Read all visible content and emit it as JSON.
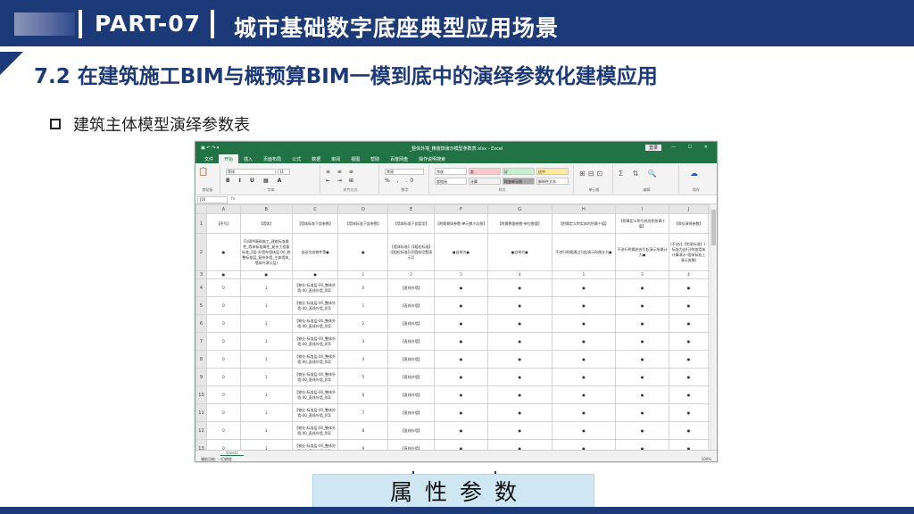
{
  "header": {
    "part": "PART-07",
    "title": "城市基础数字底座典型应用场景"
  },
  "section": {
    "title": "7.2 在建筑施工BIM与概预算BIM一模到底中的演绎参数化建模应用"
  },
  "bullet": {
    "text": "建筑主体模型演绎参数表"
  },
  "excel": {
    "window_title": "_整体外墙_精装饰演示模型参数表.xlsx - Excel",
    "sign_in": "登录",
    "tabs": [
      "文件",
      "开始",
      "插入",
      "页面布局",
      "公式",
      "数据",
      "审阅",
      "视图",
      "帮助",
      "百度网盘",
      "操作说明搜索"
    ],
    "ribbon": {
      "groups": [
        "剪贴板",
        "字体",
        "对齐方式",
        "数字",
        "样式",
        "单元格",
        "编辑",
        "保存"
      ],
      "font_name": "等线",
      "font_size": "11",
      "number_format": "常规",
      "styles": [
        {
          "label": "常规",
          "bg": "#ffffff"
        },
        {
          "label": "差",
          "bg": "#ffc7ce"
        },
        {
          "label": "好",
          "bg": "#c6efce"
        },
        {
          "label": "适中",
          "bg": "#ffeb9c"
        },
        {
          "label": "超链接",
          "bg": "#ffffff"
        },
        {
          "label": "计算",
          "bg": "#f2f2f2"
        },
        {
          "label": "检查单元格",
          "bg": "#a5a5a5"
        },
        {
          "label": "解释性文本",
          "bg": "#ffffff"
        }
      ]
    },
    "formula_bar": {
      "name_box": "J16",
      "fx": "fx"
    },
    "column_letters": [
      "A",
      "B",
      "C",
      "D",
      "E",
      "F",
      "G",
      "H",
      "I",
      "J"
    ],
    "header_row": [
      "【序号】",
      "【墙体】",
      "【墙体标准下部参数】",
      "【墙体标准下部参数】",
      "【墙体标准下部类型】",
      "【附属物体参数-单元数小边框】",
      "【附属数据参数-单位数量】",
      "【附属定义附实体的所属十值】",
      "【附属定义附引结合附所属十值】",
      "【保存演绎参数】"
    ],
    "row2": [
      "●",
      "(1)BIM演绎施工_建筑标准属性_墙体标准属性_复杂工程量标准_2层-外墙布墙体层-00_修整标准层_复杂外墙_主体墙体_墙体外演示层)",
      "自动生成物件等●",
      "●",
      "【墙体标准】(【粗粒标准】(【粗粒标准】)(【墙体设置演示】)",
      "●自带为●",
      "●自带为●",
      "不进行附属通过引起演示所属计为●",
      "不进行附属结合引起演示所属计为●",
      "(不加注【附录标准】(-标准为自行)附加墙体计算演示-墙体标准上演示参数)"
    ],
    "row3": [
      "●",
      "●",
      "●",
      "1",
      "2",
      "3",
      "4",
      "1",
      "2",
      "4"
    ],
    "data_rows": [
      [
        "0",
        "1",
        "【物业-标准层-00_整体外墙-00_直线外墙_00】",
        "0",
        "【直线外墙】",
        "●",
        "●",
        "●",
        "●",
        "●"
      ],
      [
        "0",
        "1",
        "【物业-标准层-00_整体外墙-00_直线外墙_00】",
        "1",
        "【直线外墙】",
        "●",
        "●",
        "●",
        "●",
        "●"
      ],
      [
        "0",
        "1",
        "【物业-标准层-00_整体外墙-00_直线外墙_00】",
        "2",
        "【直线外墙】",
        "●",
        "●",
        "●",
        "●",
        "●"
      ],
      [
        "0",
        "1",
        "【物业-标准层-00_整体外墙-00_直线外墙_00】",
        "3",
        "【直线外墙】",
        "●",
        "●",
        "●",
        "●",
        "●"
      ],
      [
        "0",
        "1",
        "【物业-标准层-00_整体外墙-00_直线外墙_00】",
        "4",
        "【直线外墙】",
        "●",
        "●",
        "●",
        "●",
        "●"
      ],
      [
        "0",
        "1",
        "【物业-标准层-00_整体外墙-00_直线外墙_00】",
        "5",
        "【直线外墙】",
        "●",
        "●",
        "●",
        "●",
        "●"
      ],
      [
        "0",
        "1",
        "【物业-标准层-00_整体外墙-00_直线外墙_00】",
        "6",
        "【直线外墙】",
        "●",
        "●",
        "●",
        "●",
        "●"
      ],
      [
        "0",
        "1",
        "【物业-标准层-00_整体外墙-00_直线外墙_00】",
        "7",
        "【直线外墙】",
        "●",
        "●",
        "●",
        "●",
        "●"
      ],
      [
        "0",
        "1",
        "【物业-标准层-00_整体外墙-00_直线外墙_00】",
        "8",
        "【直线外墙】",
        "●",
        "●",
        "●",
        "●",
        "●"
      ],
      [
        "0",
        "1",
        "【物业-标准层-00_整体外墙-00_直线外墙_00】",
        "9",
        "【直线外墙】",
        "●",
        "●",
        "●",
        "●",
        "●"
      ]
    ],
    "sheet_tab": "Sheet1",
    "status": "辅助功能: 一切就绪",
    "zoom": "100%"
  },
  "label": {
    "text": "属性参数"
  },
  "colors": {
    "brand": "#1c3a78",
    "excel_green": "#217346",
    "label_bg": "#cfe7f3"
  }
}
